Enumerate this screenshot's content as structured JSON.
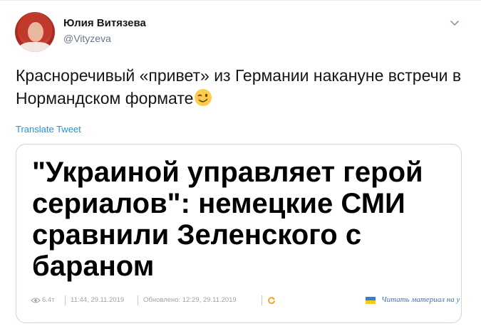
{
  "author": {
    "name": "Юлия Витязева",
    "handle": "@Vityzeva"
  },
  "tweet": {
    "text": "Красноречивый «привет» из Германии накануне встречи в Нормандском формате",
    "emoji": "winking-face",
    "translate_label": "Translate Tweet"
  },
  "card": {
    "headline": "\"Украиной управляет герой сериалов\": немецкие СМИ сравнили Зеленского с бараном",
    "views": "6.4т",
    "published": "11:44, 29.11.2019",
    "updated": "Обновлено: 12:29, 29.11.2019",
    "read_more": "Читать материал на у"
  },
  "colors": {
    "link": "#1b95e0",
    "secondary_text": "#657786",
    "border": "#ccd6dd"
  }
}
